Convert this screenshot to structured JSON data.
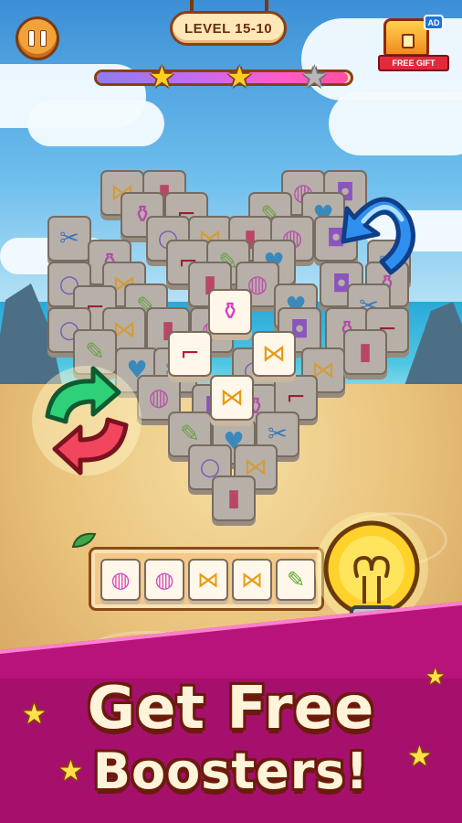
{
  "hud": {
    "level_label": "LEVEL 15-10",
    "gift": {
      "ad_badge": "AD",
      "label": "FREE GIFT"
    },
    "progress": {
      "fraction": 0.99,
      "stars_earned": 2,
      "stars_total": 3
    }
  },
  "board": {
    "tile_types": [
      "bow",
      "lipstick",
      "mirror",
      "purse",
      "perfume",
      "shoes",
      "comb",
      "heart-locket",
      "scissors",
      "ring"
    ],
    "top_tiles": [
      "perfume",
      "bow",
      "shoes",
      "bow"
    ]
  },
  "boosters": {
    "undo": "undo-arrow-icon",
    "shuffle": "shuffle-icon",
    "hint": "lightbulb-icon"
  },
  "tray": {
    "slots": [
      "mirror",
      "mirror",
      "bow",
      "bow",
      "comb"
    ]
  },
  "promo": {
    "line1": "Get Free",
    "line2": "Boosters!"
  },
  "colors": {
    "accent_magenta": "#b8137a",
    "star_gold": "#ffcf1f",
    "frame_brown": "#8a3f12"
  }
}
